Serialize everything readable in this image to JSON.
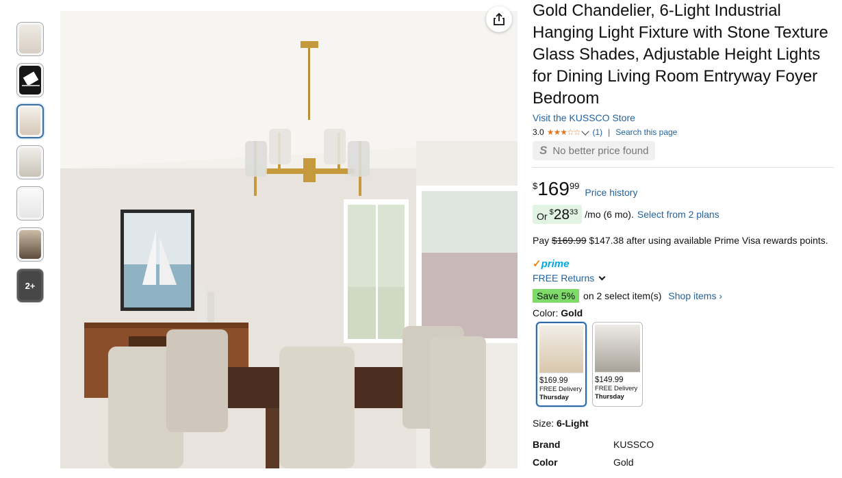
{
  "thumbnails": [
    {
      "name": "thumbnail-1",
      "bg": "#e9e5df"
    },
    {
      "name": "thumbnail-2",
      "bg": "#1b1b1b"
    },
    {
      "name": "thumbnail-3",
      "bg": "#efeae3"
    },
    {
      "name": "thumbnail-4",
      "bg": "#ebe7e2"
    },
    {
      "name": "thumbnail-5",
      "bg": "#f4f4f4"
    },
    {
      "name": "thumbnail-6",
      "bg": "#8a7a68"
    },
    {
      "name": "thumbnail-more",
      "bg": "#6a6a6a"
    }
  ],
  "thumb_more_label": "2+",
  "product": {
    "title": "Gold Chandelier, 6-Light Industrial Hanging Light Fixture with Stone Texture Glass Shades, Adjustable Height Lights for Dining Living Room Entryway Foyer Bedroom",
    "store_link": "Visit the KUSSCO Store",
    "rating": "3.0",
    "stars": "★★★☆☆",
    "rating_count": "(1)",
    "separator": "|",
    "search_page": "Search this page",
    "no_better_price_icon": "S",
    "no_better_price": "No better price found"
  },
  "price": {
    "currency": "$",
    "whole": "169",
    "fraction": "99",
    "history_link": "Price history"
  },
  "plan": {
    "or": "Or",
    "currency": "$",
    "whole": "28",
    "fraction": "33",
    "per": "/mo (6 mo).",
    "select_link": "Select from 2 plans"
  },
  "visa": {
    "pay": "Pay",
    "old_price": "$169.99",
    "new_price": "$147.38",
    "rest": "after using available Prime Visa rewards points."
  },
  "prime": {
    "check": "✓",
    "label": "prime"
  },
  "returns": {
    "label": "FREE Returns"
  },
  "save": {
    "badge": "Save 5%",
    "text": "on 2 select item(s)",
    "shop_link": "Shop items ›"
  },
  "color": {
    "label": "Color:",
    "value": "Gold",
    "options": [
      {
        "price": "$169.99",
        "delivery": "FREE Delivery",
        "day": "Thursday"
      },
      {
        "price": "$149.99",
        "delivery": "FREE Delivery",
        "day": "Thursday"
      }
    ]
  },
  "size": {
    "label": "Size:",
    "value": "6-Light"
  },
  "specs": [
    {
      "key": "Brand",
      "value": "KUSSCO"
    },
    {
      "key": "Color",
      "value": "Gold"
    }
  ],
  "colors": {
    "link": "#2162a1",
    "star": "#de7921",
    "save_badge": "#7fda69",
    "plan_bg": "#e3f3e3",
    "prime_check": "#f08804",
    "prime_text": "#00a8e1"
  }
}
